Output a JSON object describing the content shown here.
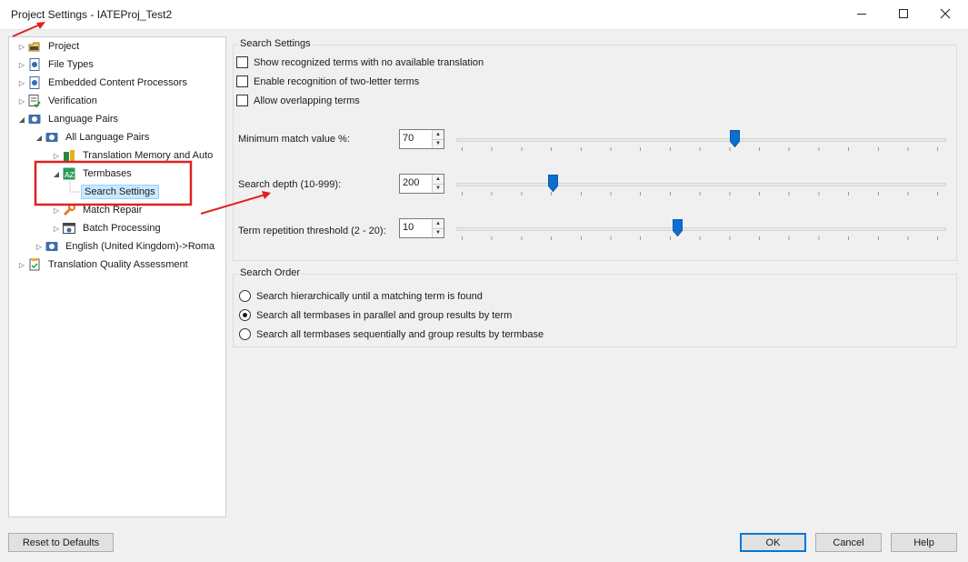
{
  "window": {
    "title": "Project Settings - IATEProj_Test2",
    "minimize_icon": "minimize-icon",
    "maximize_icon": "maximize-icon",
    "close_icon": "close-icon"
  },
  "tree": {
    "items": [
      {
        "label": "Project",
        "icon": "project-icon"
      },
      {
        "label": "File Types",
        "icon": "file-types-icon"
      },
      {
        "label": "Embedded Content Processors",
        "icon": "embedded-content-icon"
      },
      {
        "label": "Verification",
        "icon": "verification-icon"
      },
      {
        "label": "Language Pairs",
        "icon": "language-pairs-icon"
      },
      {
        "label": "All Language Pairs",
        "icon": "language-pairs-icon"
      },
      {
        "label": "Translation Memory and Auto",
        "icon": "translation-memory-icon"
      },
      {
        "label": "Termbases",
        "icon": "termbase-icon"
      },
      {
        "label": "Search Settings",
        "icon": ""
      },
      {
        "label": "Match Repair",
        "icon": "wrench-icon"
      },
      {
        "label": "Batch Processing",
        "icon": "batch-processing-icon"
      },
      {
        "label": "English (United Kingdom)->Roma",
        "icon": "language-pairs-icon"
      },
      {
        "label": "Translation Quality Assessment",
        "icon": "quality-assessment-icon"
      }
    ],
    "selected": "Search Settings"
  },
  "search_settings": {
    "title": "Search Settings",
    "checkboxes": [
      {
        "label": "Show recognized terms with no available translation",
        "checked": false
      },
      {
        "label": "Enable recognition of two-letter terms",
        "checked": false
      },
      {
        "label": "Allow overlapping terms",
        "checked": false
      }
    ],
    "min_match": {
      "label": "Minimum match value %:",
      "value": "70",
      "slider_fraction": 0.57
    },
    "search_depth": {
      "label": "Search depth (10-999):",
      "value": "200",
      "slider_fraction": 0.19
    },
    "term_repetition": {
      "label": "Term repetition threshold (2 - 20):",
      "value": "10",
      "slider_fraction": 0.45
    }
  },
  "search_order": {
    "title": "Search Order",
    "options": [
      {
        "label": "Search hierarchically until a matching term is found",
        "checked": false
      },
      {
        "label": "Search all termbases in parallel and group results by term",
        "checked": true
      },
      {
        "label": "Search all termbases sequentially and group results by termbase",
        "checked": false
      }
    ]
  },
  "buttons": {
    "reset": "Reset to Defaults",
    "ok": "OK",
    "cancel": "Cancel",
    "help": "Help"
  },
  "colors": {
    "accent": "#0078d7",
    "slider_thumb": "#0a6fd1",
    "annotation": "#e02020",
    "selection": "#cce8ff"
  }
}
